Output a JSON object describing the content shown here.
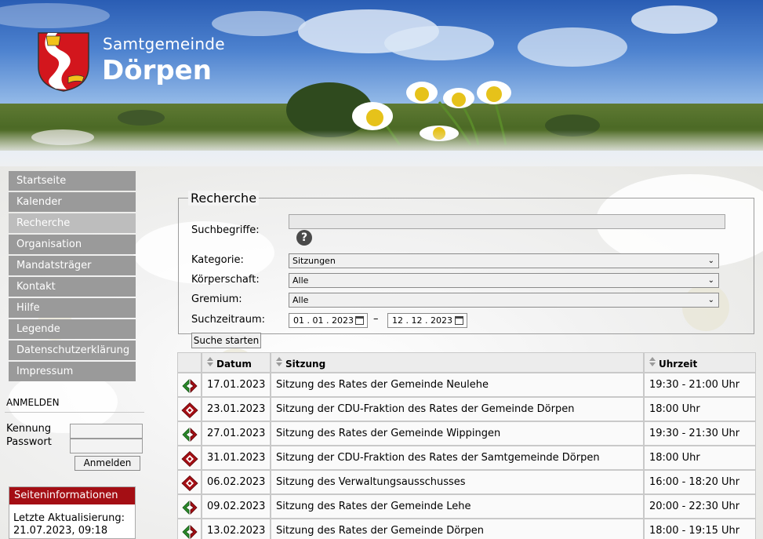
{
  "header": {
    "subtitle": "Samtgemeinde",
    "title": "Dörpen"
  },
  "nav": {
    "items": [
      {
        "label": "Startseite"
      },
      {
        "label": "Kalender"
      },
      {
        "label": "Recherche",
        "active": true
      },
      {
        "label": "Organisation"
      },
      {
        "label": "Mandatsträger"
      },
      {
        "label": "Kontakt"
      },
      {
        "label": "Hilfe"
      },
      {
        "label": "Legende"
      },
      {
        "label": "Datenschutzerklärung"
      },
      {
        "label": "Impressum"
      }
    ]
  },
  "login": {
    "title": "ANMELDEN",
    "user_label": "Kennung",
    "password_label": "Passwort",
    "user_value": "",
    "password_value": "",
    "button_label": "Anmelden"
  },
  "info": {
    "title": "Seiteninformationen",
    "line1": "Letzte Aktualisierung:",
    "line2": "21.07.2023, 09:18"
  },
  "search": {
    "legend": "Recherche",
    "term_label": "Suchbegriffe:",
    "term_value": "",
    "help_glyph": "?",
    "category_label": "Kategorie:",
    "category_value": "Sitzungen",
    "body_label": "Körperschaft:",
    "body_value": "Alle",
    "committee_label": "Gremium:",
    "committee_value": "Alle",
    "period_label": "Suchzeitraum:",
    "date_from": "01 . 01 . 2023",
    "date_to": "12 . 12 . 2023",
    "period_dash": "–",
    "submit_label": "Suche starten"
  },
  "table": {
    "columns": [
      "Datum",
      "Sitzung",
      "Uhrzeit"
    ],
    "rows": [
      {
        "icon": "arrows-icon",
        "date": "17.01.2023",
        "title": "Sitzung des Rates der Gemeinde Neulehe",
        "time": "19:30 - 21:00 Uhr"
      },
      {
        "icon": "diamond-icon",
        "date": "23.01.2023",
        "title": "Sitzung der CDU-Fraktion des Rates der Gemeinde Dörpen",
        "time": "18:00 Uhr"
      },
      {
        "icon": "arrows-icon",
        "date": "27.01.2023",
        "title": "Sitzung des Rates der Gemeinde Wippingen",
        "time": "19:30 - 21:30 Uhr"
      },
      {
        "icon": "diamond-icon",
        "date": "31.01.2023",
        "title": "Sitzung der CDU-Fraktion des Rates der Samtgemeinde Dörpen",
        "time": "18:00 Uhr"
      },
      {
        "icon": "diamond-icon",
        "date": "06.02.2023",
        "title": "Sitzung des Verwaltungsausschusses",
        "time": "16:00 - 18:20 Uhr"
      },
      {
        "icon": "arrows-icon",
        "date": "09.02.2023",
        "title": "Sitzung des Rates der Gemeinde Lehe",
        "time": "20:00 - 22:30 Uhr"
      },
      {
        "icon": "arrows-icon",
        "date": "13.02.2023",
        "title": "Sitzung des Rates der Gemeinde Dörpen",
        "time": "18:00 - 19:15 Uhr"
      }
    ]
  },
  "colors": {
    "nav_bg": "#9a9a9a",
    "nav_active_bg": "#bdbdbd",
    "info_head_bg": "#a40e14",
    "icon_green": "#2a8a2a",
    "icon_red": "#a40e14"
  }
}
